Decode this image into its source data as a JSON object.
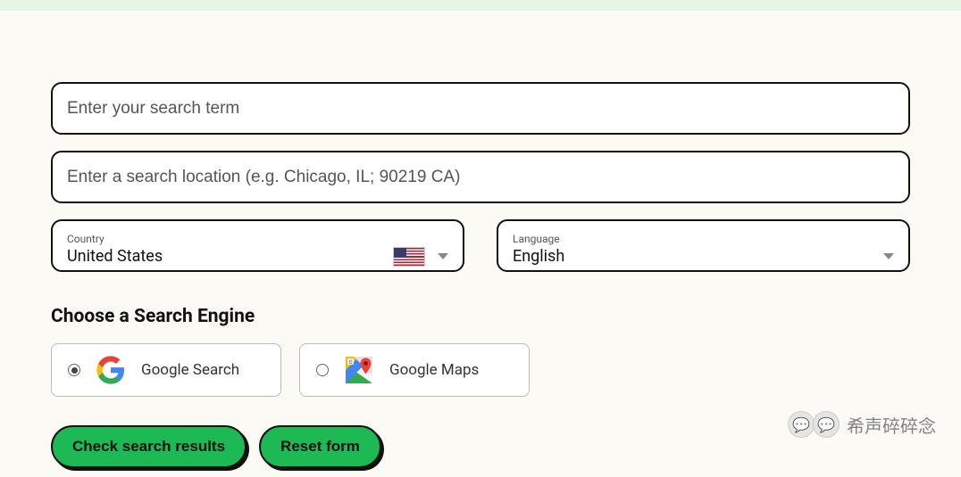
{
  "search_term_placeholder": "Enter your search term",
  "search_location_placeholder": "Enter a search location (e.g. Chicago, IL; 90219 CA)",
  "country": {
    "label": "Country",
    "value": "United States"
  },
  "language": {
    "label": "Language",
    "value": "English"
  },
  "engine_section_title": "Choose a Search Engine",
  "engines": {
    "google_search": "Google Search",
    "google_maps": "Google Maps"
  },
  "buttons": {
    "check": "Check search results",
    "reset": "Reset form"
  },
  "watermark": "希声碎碎念"
}
